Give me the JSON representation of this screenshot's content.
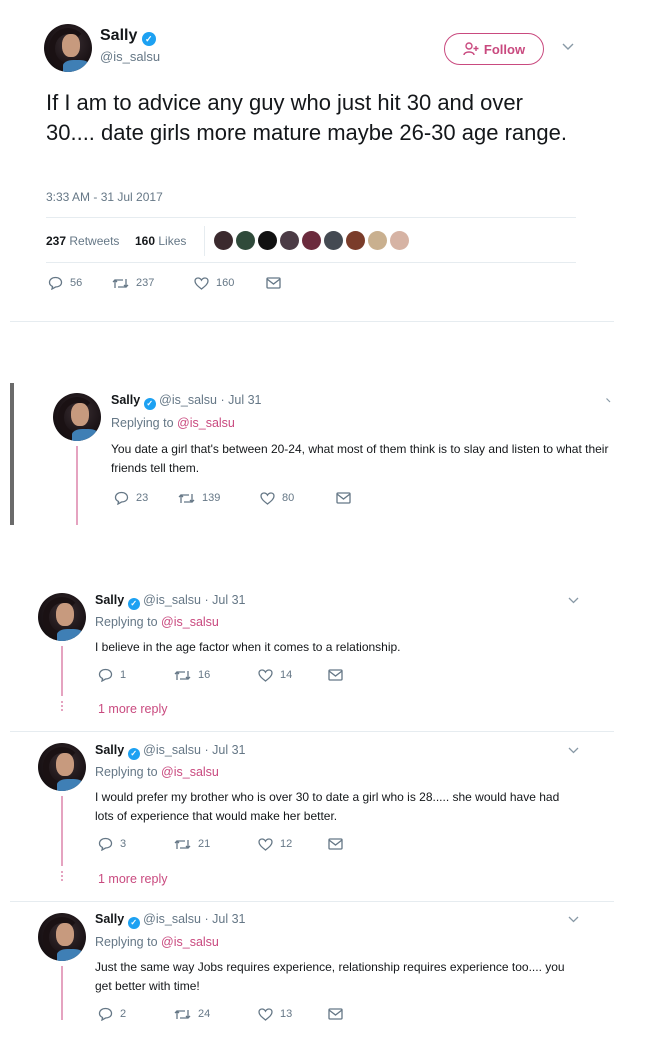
{
  "main_tweet": {
    "name": "Sally",
    "handle": "@is_salsu",
    "follow_label": "Follow",
    "text": "If I am to advice any guy who just hit 30 and over 30.... date girls more mature maybe 26-30 age range.",
    "timestamp": "3:33 AM - 31 Jul 2017",
    "retweets_count": "237",
    "retweets_label": "Retweets",
    "likes_count": "160",
    "likes_label": "Likes",
    "replies": "56",
    "retweets": "237",
    "likes": "160"
  },
  "replies": [
    {
      "name": "Sally",
      "handle": "@is_salsu",
      "date": "· Jul 31",
      "replying_prefix": "Replying to",
      "replying_to": "@is_salsu",
      "text": "You date a girl that's between 20-24, what most of them think is to slay and listen to what their friends tell them.",
      "replies": "23",
      "retweets": "139",
      "likes": "80"
    },
    {
      "name": "Sally",
      "handle": "@is_salsu",
      "date": "· Jul 31",
      "replying_prefix": "Replying to",
      "replying_to": "@is_salsu",
      "text": "I believe in the age factor when it comes to a relationship.",
      "replies": "1",
      "retweets": "16",
      "likes": "14",
      "more": "1 more reply"
    },
    {
      "name": "Sally",
      "handle": "@is_salsu",
      "date": "· Jul 31",
      "replying_prefix": "Replying to",
      "replying_to": "@is_salsu",
      "text": "I would prefer my brother who is over 30 to date a girl who is 28..... she would have had lots of experience that would make her better.",
      "replies": "3",
      "retweets": "21",
      "likes": "12",
      "more": "1 more reply"
    },
    {
      "name": "Sally",
      "handle": "@is_salsu",
      "date": "· Jul 31",
      "replying_prefix": "Replying to",
      "replying_to": "@is_salsu",
      "text": "Just the same way Jobs requires experience, relationship requires experience too.... you get better with time!",
      "replies": "2",
      "retweets": "24",
      "likes": "13"
    }
  ],
  "colors": {
    "accent": "#c94a7f",
    "verified": "#1da1f2",
    "muted": "#657786",
    "thread_line": "#e5a3c0"
  },
  "liker_avatar_colors": [
    "#3b2a2e",
    "#2f4a3a",
    "#111111",
    "#4b3b45",
    "#6b2b3d",
    "#444a52",
    "#7a3c2a",
    "#c9b08f",
    "#d6b3a4"
  ]
}
